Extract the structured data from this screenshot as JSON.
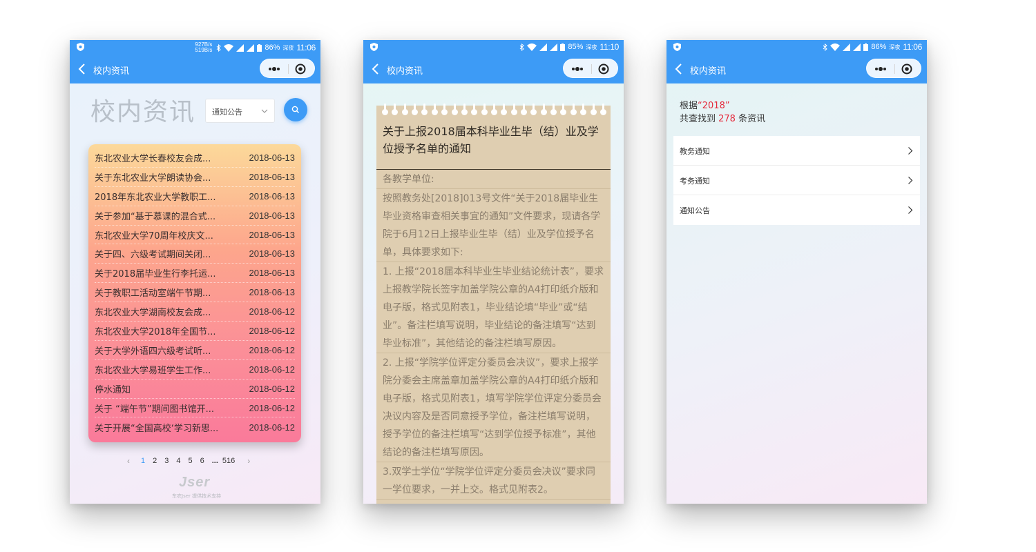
{
  "colors": {
    "primary": "#3d9bf6",
    "highlight": "#e5293b",
    "paper": "#dfceb1"
  },
  "phone1": {
    "status": {
      "speed_up": "927B/s",
      "speed_down": "519B/s",
      "battery": "86%",
      "period": "深夜",
      "time": "11:06"
    },
    "nav_title": "校内资讯",
    "big_title": "校内资讯",
    "select_value": "通知公告",
    "news": [
      {
        "title": "东北农业大学长春校友会成...",
        "date": "2018-06-13"
      },
      {
        "title": "关于东北农业大学朗读协会...",
        "date": "2018-06-13"
      },
      {
        "title": "2018年东北农业大学教职工...",
        "date": "2018-06-13"
      },
      {
        "title": "关于参加“基于慕课的混合式...",
        "date": "2018-06-13"
      },
      {
        "title": "东北农业大学70周年校庆文...",
        "date": "2018-06-13"
      },
      {
        "title": "关于四、六级考试期间关闭...",
        "date": "2018-06-13"
      },
      {
        "title": "关于2018届毕业生行李托运...",
        "date": "2018-06-13"
      },
      {
        "title": "关于教职工活动室端午节期...",
        "date": "2018-06-13"
      },
      {
        "title": "东北农业大学湖南校友会成...",
        "date": "2018-06-12"
      },
      {
        "title": "东北农业大学2018年全国节...",
        "date": "2018-06-12"
      },
      {
        "title": "关于大学外语四六级考试听...",
        "date": "2018-06-12"
      },
      {
        "title": "东北农业大学易班学生工作...",
        "date": "2018-06-12"
      },
      {
        "title": "停水通知",
        "date": "2018-06-12"
      },
      {
        "title": "关于 “端午节”期间图书馆开...",
        "date": "2018-06-12"
      },
      {
        "title": "关于开展“全国高校‘学习新思...",
        "date": "2018-06-12"
      }
    ],
    "pagination": {
      "prev": "‹",
      "pages": [
        "1",
        "2",
        "3",
        "4",
        "5",
        "6"
      ],
      "ellipsis": "...",
      "last": "516",
      "next": "›",
      "current": "1"
    },
    "footer_logo": "Jser",
    "footer_text": "东农Jser 提供技术支持"
  },
  "phone2": {
    "status": {
      "battery": "85%",
      "period": "深夜",
      "time": "11:10"
    },
    "nav_title": "校内资讯",
    "article_title": "关于上报2018届本科毕业生毕（结）业及学位授予名单的通知",
    "paragraphs": [
      "各教学单位:",
      "按照教务处[2018]013号文件“关于2018届毕业生毕业资格审查相关事宜的通知”文件要求，现请各学院于6月12日上报毕业生毕（结）业及学位授予名单，具体要求如下:",
      "1. 上报“2018届本科毕业生毕业结论统计表”，要求上报教学院长签字加盖学院公章的A4打印纸介版和电子版，格式见附表1，毕业结论填“毕业”或“结业”。备注栏填写说明，毕业结论的备注填写“达到毕业标准”，其他结论的备注栏填写原因。",
      "2. 上报“学院学位评定分委员会决议”，要求上报学院分委会主席盖章加盖学院公章的A4打印纸介版和电子版，格式见附表1，填写学院学位评定分委员会决议内容及是否同意授予学位，备注栏填写说明，授予学位的备注栏填写“达到学位授予标准”，其他结论的备注栏填写原因。",
      "3.双学士学位“学院学位评定分委员会决议”要求同一学位要求，一并上交。格式见附表2。"
    ]
  },
  "phone3": {
    "status": {
      "battery": "86%",
      "period": "深夜",
      "time": "11:06"
    },
    "nav_title": "校内资讯",
    "result": {
      "prefix": "根据",
      "keyword": "“2018”",
      "found_prefix": "共查找到 ",
      "count": "278",
      "found_suffix": " 条资讯"
    },
    "categories": [
      "教务通知",
      "考务通知",
      "通知公告"
    ]
  }
}
